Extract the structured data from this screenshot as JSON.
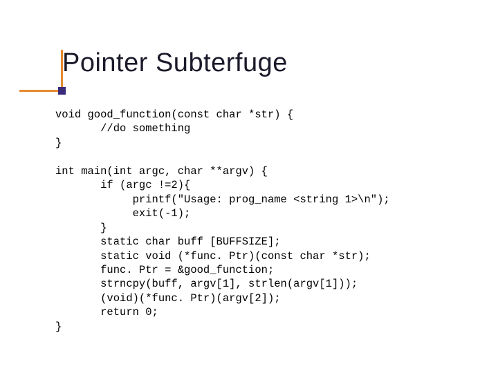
{
  "slide": {
    "title": "Pointer Subterfuge",
    "code": {
      "l01": "void good_function(const char *str) {",
      "l02": "       //do something",
      "l03": "}",
      "l04": "",
      "l05": "int main(int argc, char **argv) {",
      "l06": "       if (argc !=2){",
      "l07": "            printf(\"Usage: prog_name <string 1>\\n\");",
      "l08": "            exit(-1);",
      "l09": "       }",
      "l10": "       static char buff [BUFFSIZE];",
      "l11": "       static void (*func. Ptr)(const char *str);",
      "l12": "       func. Ptr = &good_function;",
      "l13": "       strncpy(buff, argv[1], strlen(argv[1]));",
      "l14": "       (void)(*func. Ptr)(argv[2]);",
      "l15": "       return 0;",
      "l16": "}"
    }
  }
}
